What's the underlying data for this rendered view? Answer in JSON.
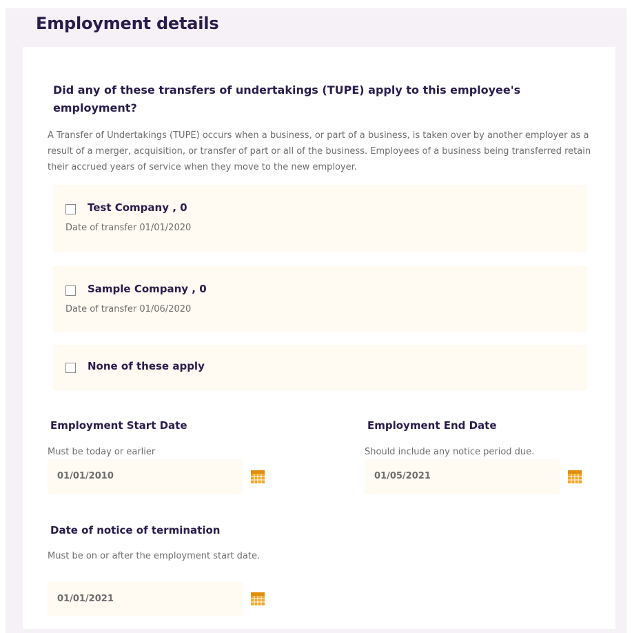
{
  "page": {
    "title": "Employment details"
  },
  "tupe": {
    "question": "Did any of these transfers of undertakings (TUPE) apply to this employee's employment?",
    "help": "A Transfer of Undertakings (TUPE) occurs when a business, or part of a business, is taken over by another employer as a result of a merger, acquisition, or transfer of part or all of the business. Employees of a business being transferred retain their accrued years of service when they move to the new employer.",
    "options": [
      {
        "label": "Test Company , 0",
        "sub": "Date of transfer 01/01/2020",
        "checked": false
      },
      {
        "label": "Sample Company , 0",
        "sub": "Date of transfer 01/06/2020",
        "checked": false
      },
      {
        "label": "None of these apply",
        "checked": false
      }
    ]
  },
  "start_date": {
    "title": "Employment Start Date",
    "hint": "Must be today or earlier",
    "value": "01/01/2010"
  },
  "end_date": {
    "title": "Employment End Date",
    "hint": "Should include any notice period due.",
    "value": "01/05/2021"
  },
  "notice_date": {
    "title": "Date of notice of termination",
    "hint": "Must be on or after the employment start date.",
    "value": "01/01/2021"
  },
  "icons": {
    "calendar": "calendar-icon",
    "checkbox": "checkbox-unchecked"
  },
  "colors": {
    "heading": "#2a1c4c",
    "muted_text": "#6d6d6d",
    "page_background": "#f5f1f6",
    "option_background": "#fffaf2",
    "calendar_icon": "#f5a623"
  }
}
